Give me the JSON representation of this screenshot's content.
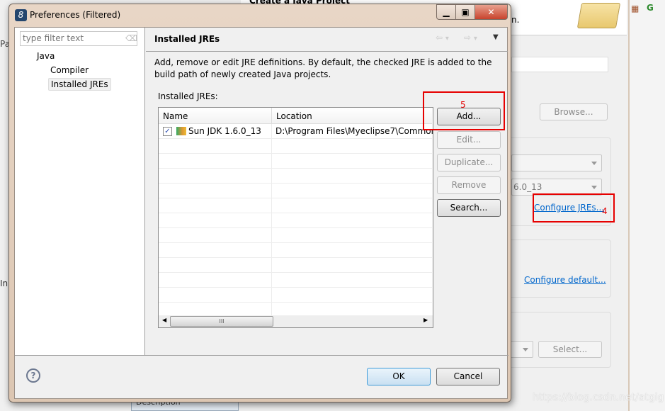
{
  "background": {
    "wizard_title": "Create a Java Project",
    "wizard_desc_tail": "n.",
    "left_tab": "Pa",
    "left_label": "In",
    "browse_label": "Browse...",
    "jre_combo_value": "6.0_13",
    "configure_jres_link": "Configure JREs...",
    "configure_default_link": "Configure default...",
    "select_label": "Select...",
    "bottom_tab": "Description",
    "watermark": "https://blog.csdn.net/atgig"
  },
  "annotations": {
    "step5": "5",
    "step4": "4",
    "color": "#e60000"
  },
  "dialog": {
    "title": "Preferences (Filtered)",
    "filter_placeholder": "type filter text",
    "tree": [
      {
        "label": "Java"
      },
      {
        "label": "Compiler"
      },
      {
        "label": "Installed JREs",
        "selected": true
      }
    ],
    "page_title": "Installed JREs",
    "description": "Add, remove or edit JRE definitions. By default, the checked JRE is added to the build path of newly created Java projects.",
    "list_label": "Installed JREs:",
    "table": {
      "columns": [
        "Name",
        "Location"
      ],
      "rows": [
        {
          "checked": true,
          "name": "Sun JDK 1.6.0_13",
          "location": "D:\\Program Files\\Myeclipse7\\Common"
        }
      ]
    },
    "buttons": {
      "add": "Add...",
      "edit": "Edit...",
      "duplicate": "Duplicate...",
      "remove": "Remove",
      "search": "Search..."
    },
    "ok": "OK",
    "cancel": "Cancel",
    "scroll_thumb": "III"
  }
}
